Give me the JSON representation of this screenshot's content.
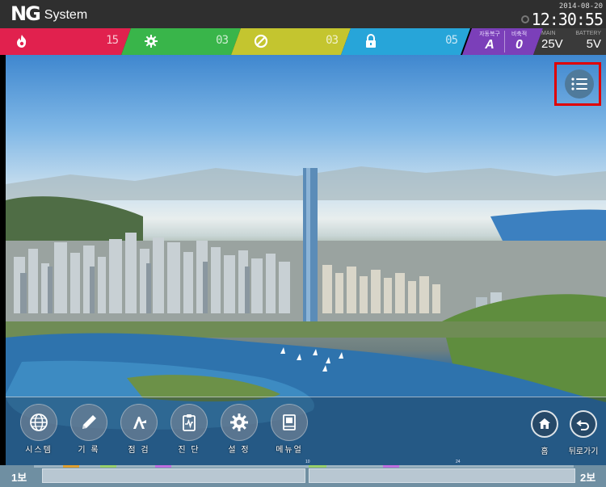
{
  "header": {
    "logo": "NG",
    "system_label": "System",
    "date": "2014-08-20",
    "time": "12:30:55"
  },
  "status": {
    "fire": {
      "icon": "fire-icon",
      "count": "15",
      "color": "#e1214e"
    },
    "fault": {
      "icon": "gear-icon",
      "count": "03",
      "color": "#39b54a"
    },
    "disabled": {
      "icon": "block-icon",
      "count": "03",
      "color": "#c4c52f"
    },
    "locked": {
      "icon": "lock-icon",
      "count": "05",
      "color": "#27a5d9"
    },
    "auto_recover": {
      "label": "자동복구",
      "value": "A"
    },
    "emergency": {
      "label": "비축적",
      "value": "0"
    },
    "main": {
      "label": "MAIN",
      "value": "25V"
    },
    "battery": {
      "label": "BATTERY",
      "value": "5V"
    }
  },
  "toolbar": {
    "items": [
      {
        "label": "시스템",
        "icon": "globe-icon"
      },
      {
        "label": "기 록",
        "icon": "pencil-icon"
      },
      {
        "label": "점 검",
        "icon": "inspect-icon"
      },
      {
        "label": "진 단",
        "icon": "clipboard-icon"
      },
      {
        "label": "설 정",
        "icon": "settings-icon"
      },
      {
        "label": "메뉴얼",
        "icon": "manual-icon"
      }
    ],
    "home_label": "홈",
    "back_label": "뒤로가기"
  },
  "footer": {
    "left_label": "1보",
    "right_label": "2보",
    "tick_labels": [
      "10",
      "24"
    ]
  },
  "list_button": {
    "icon": "list-icon"
  }
}
